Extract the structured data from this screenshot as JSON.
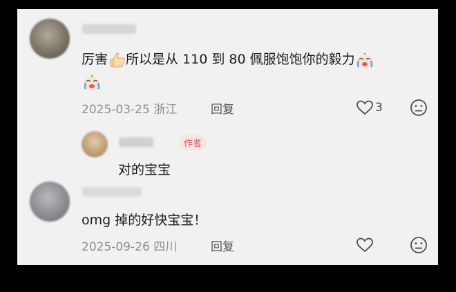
{
  "comments": [
    {
      "text_before": "厉害",
      "text_after": "所以是从 110 到 80 佩服饱饱你的毅力",
      "date": "2025-03-25",
      "location": "浙江",
      "reply_label": "回复",
      "likes": "3"
    },
    {
      "text": "对的宝宝",
      "author_badge": "作者"
    },
    {
      "text": "omg 掉的好快宝宝！",
      "date": "2025-09-26",
      "location": "四川",
      "reply_label": "回复"
    }
  ],
  "icons": {
    "thumbs_up": "thumbs-up-emoji",
    "crying_baby": "crying-baby-emoji",
    "like": "heart-outline-icon",
    "dislike": "frown-icon"
  },
  "colors": {
    "panel": "#f1f1f1",
    "text": "#1b1b1b",
    "meta": "#8e8e8e",
    "badge_bg": "#fbe3e3",
    "badge_fg": "#e2526a"
  }
}
